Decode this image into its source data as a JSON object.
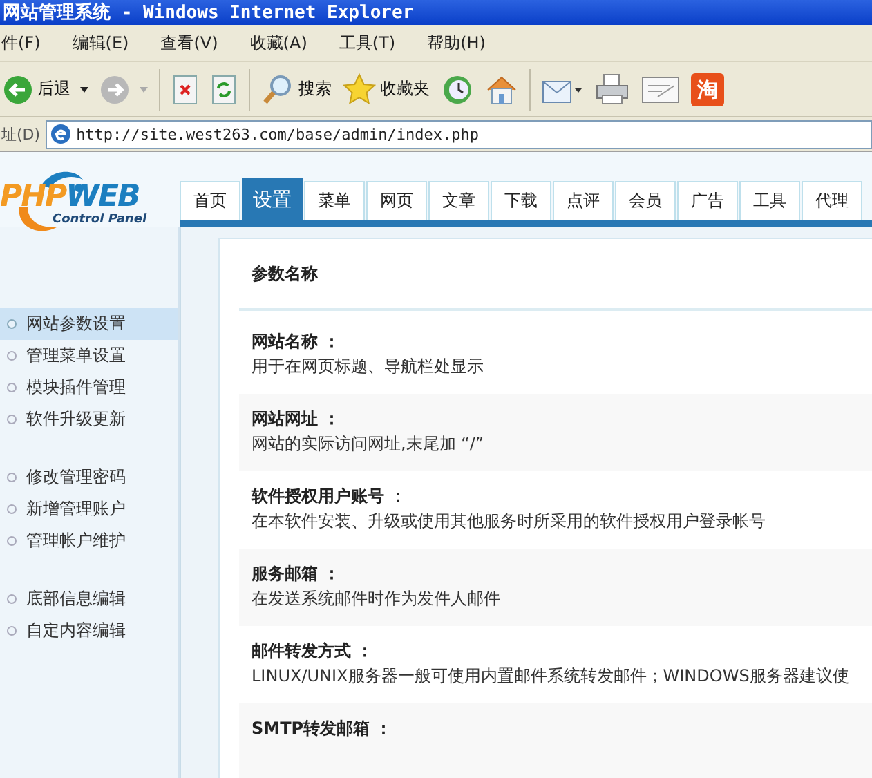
{
  "window": {
    "title": "网站管理系统 - Windows Internet Explorer"
  },
  "menu_bar": [
    "件(F)",
    "编辑(E)",
    "查看(V)",
    "收藏(A)",
    "工具(T)",
    "帮助(H)"
  ],
  "toolbar": [
    {
      "kind": "back",
      "label": "后退"
    },
    {
      "kind": "forward"
    },
    {
      "kind": "separator"
    },
    {
      "kind": "stop"
    },
    {
      "kind": "refresh"
    },
    {
      "kind": "separator"
    },
    {
      "kind": "search",
      "label": "搜索"
    },
    {
      "kind": "favorites",
      "label": "收藏夹"
    },
    {
      "kind": "history"
    },
    {
      "kind": "home"
    },
    {
      "kind": "separator"
    },
    {
      "kind": "mail"
    },
    {
      "kind": "print"
    },
    {
      "kind": "edit"
    },
    {
      "kind": "taobao",
      "label": "淘"
    }
  ],
  "address_bar": {
    "label": "址(D)",
    "url": "http://site.west263.com/base/admin/index.php"
  },
  "logo": {
    "part_1": "PHP",
    "part_2": "WEB",
    "subtitle": "Control Panel"
  },
  "tabs": [
    {
      "label": "首页",
      "selected": false
    },
    {
      "label": "设置",
      "selected": true
    },
    {
      "label": "菜单",
      "selected": false
    },
    {
      "label": "网页",
      "selected": false
    },
    {
      "label": "文章",
      "selected": false
    },
    {
      "label": "下载",
      "selected": false
    },
    {
      "label": "点评",
      "selected": false
    },
    {
      "label": "会员",
      "selected": false
    },
    {
      "label": "广告",
      "selected": false
    },
    {
      "label": "工具",
      "selected": false
    },
    {
      "label": "代理",
      "selected": false
    }
  ],
  "sidebar": {
    "groups": [
      [
        {
          "label": "网站参数设置",
          "selected": true
        },
        {
          "label": "管理菜单设置",
          "selected": false
        },
        {
          "label": "模块插件管理",
          "selected": false
        },
        {
          "label": "软件升级更新",
          "selected": false
        }
      ],
      [
        {
          "label": "修改管理密码",
          "selected": false
        },
        {
          "label": "新增管理账户",
          "selected": false
        },
        {
          "label": "管理帐户维护",
          "selected": false
        }
      ],
      [
        {
          "label": "底部信息编辑",
          "selected": false
        },
        {
          "label": "自定内容编辑",
          "selected": false
        }
      ]
    ]
  },
  "content": {
    "header": "参数名称",
    "rows": [
      {
        "name": "网站名称 ：",
        "description": "用于在网页标题、导航栏处显示"
      },
      {
        "name": "网站网址 ：",
        "description": "网站的实际访问网址,末尾加 “/”"
      },
      {
        "name": "软件授权用户账号 ：",
        "description": "在本软件安装、升级或使用其他服务时所采用的软件授权用户登录帐号"
      },
      {
        "name": "服务邮箱 ：",
        "description": "在发送系统邮件时作为发件人邮件"
      },
      {
        "name": "邮件转发方式 ：",
        "description": "LINUX/UNIX服务器一般可使用内置邮件系统转发邮件；WINDOWS服务器建议使"
      },
      {
        "name": "SMTP转发邮箱 ："
      }
    ]
  }
}
